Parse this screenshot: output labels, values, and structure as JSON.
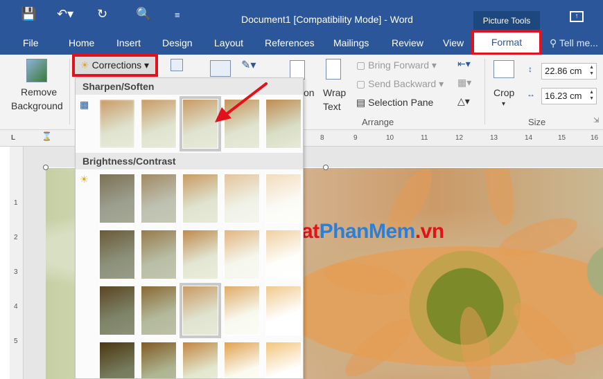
{
  "window": {
    "title": "Document1 [Compatibility Mode] - Word",
    "context_tab_group": "Picture Tools"
  },
  "tabs": [
    "File",
    "Home",
    "Insert",
    "Design",
    "Layout",
    "References",
    "Mailings",
    "Review",
    "View"
  ],
  "active_tab": "Format",
  "tell_me": "Tell me...",
  "ribbon": {
    "remove_background": [
      "Remove",
      "Background"
    ],
    "corrections": "Corrections",
    "wrap_text": [
      "Wrap",
      "Text"
    ],
    "position_partial": "on",
    "bring_forward": "Bring Forward",
    "send_backward": "Send Backward",
    "selection_pane": "Selection Pane",
    "arrange_label": "Arrange",
    "crop": "Crop",
    "height": "22.86 cm",
    "width": "16.23 cm",
    "size_label": "Size"
  },
  "gallery": {
    "sharpen_header": "Sharpen/Soften",
    "brightness_header": "Brightness/Contrast"
  },
  "ruler": {
    "top_ticks": [
      "8",
      "9",
      "10",
      "11",
      "12",
      "13",
      "14",
      "15",
      "16"
    ],
    "side_ticks": [
      "1",
      "2",
      "3",
      "4",
      "5"
    ]
  },
  "watermark": {
    "part1": "ThuThuat",
    "part2": "PhanMem",
    "part3": ".vn"
  },
  "colors": {
    "word_blue": "#2b579a",
    "highlight_red": "#e3111b"
  },
  "icons": [
    "save-icon",
    "undo-icon",
    "redo-icon",
    "print-preview-icon",
    "customize-qat-icon",
    "ribbon-display-icon",
    "lightbulb-icon"
  ]
}
